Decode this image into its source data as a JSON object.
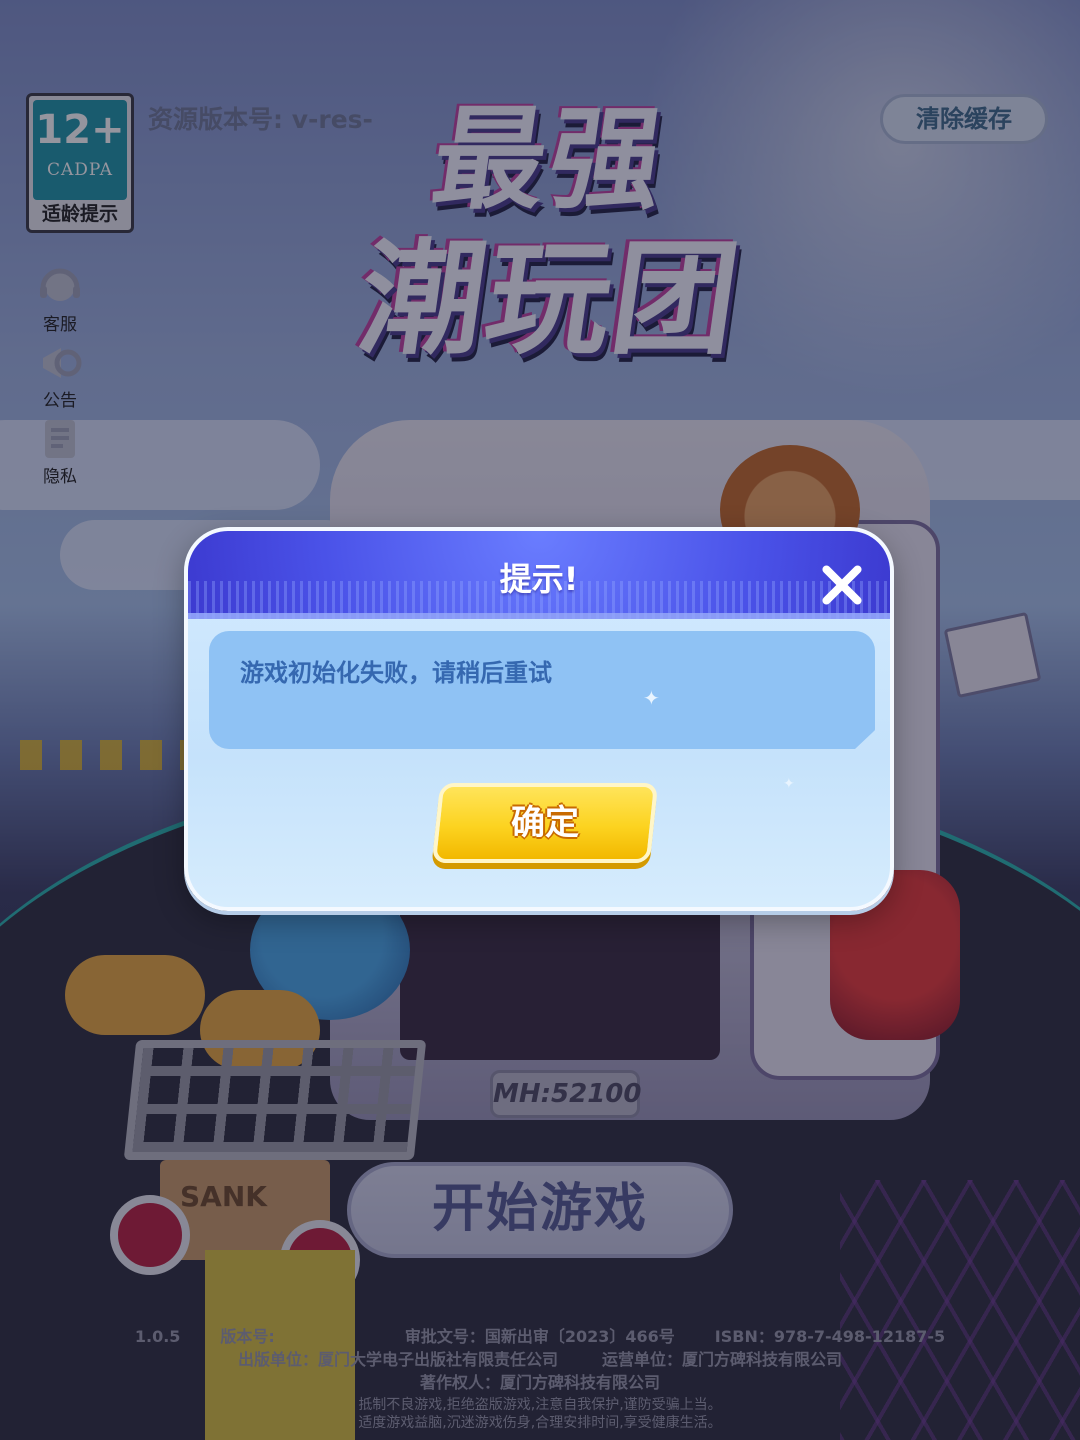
{
  "background": {
    "title_line1": "最强",
    "title_line2": "潮玩团",
    "plate_text": "MH:52100",
    "box_text": "SANK"
  },
  "hud": {
    "age_rating": {
      "number": "12+",
      "org": "CADPA",
      "label": "适龄提示"
    },
    "resource_version": "资源版本号: v-res-",
    "clear_cache_label": "清除缓存",
    "side_buttons": [
      {
        "label": "客服",
        "icon": "customer-service-icon"
      },
      {
        "label": "公告",
        "icon": "announcement-icon"
      },
      {
        "label": "隐私",
        "icon": "privacy-icon"
      }
    ],
    "start_button_label": "开始游戏"
  },
  "footer": {
    "version": "1.0.5",
    "version_label": "版本号:",
    "approval": "审批文号：国新出审〔2023〕466号",
    "isbn": "ISBN：978-7-498-12187-5",
    "publisher": "出版单位：厦门大学电子出版社有限责任公司",
    "operator": "运营单位：厦门方碑科技有限公司",
    "copyright": "著作权人：厦门方碑科技有限公司",
    "notice_line1": "抵制不良游戏,拒绝盗版游戏,注意自我保护,谨防受骗上当。",
    "notice_line2": "适度游戏益脑,沉迷游戏伤身,合理安排时间,享受健康生活。"
  },
  "dialog": {
    "title": "提示!",
    "message": "游戏初始化失败，请稍后重试",
    "confirm_label": "确定",
    "close_icon": "close-icon"
  },
  "colors": {
    "dialog_header": "#4a52e8",
    "dialog_body": "#c5e2fb",
    "message_panel": "#8fc2f4",
    "message_text": "#3568b0",
    "confirm_button": "#fcd320"
  }
}
